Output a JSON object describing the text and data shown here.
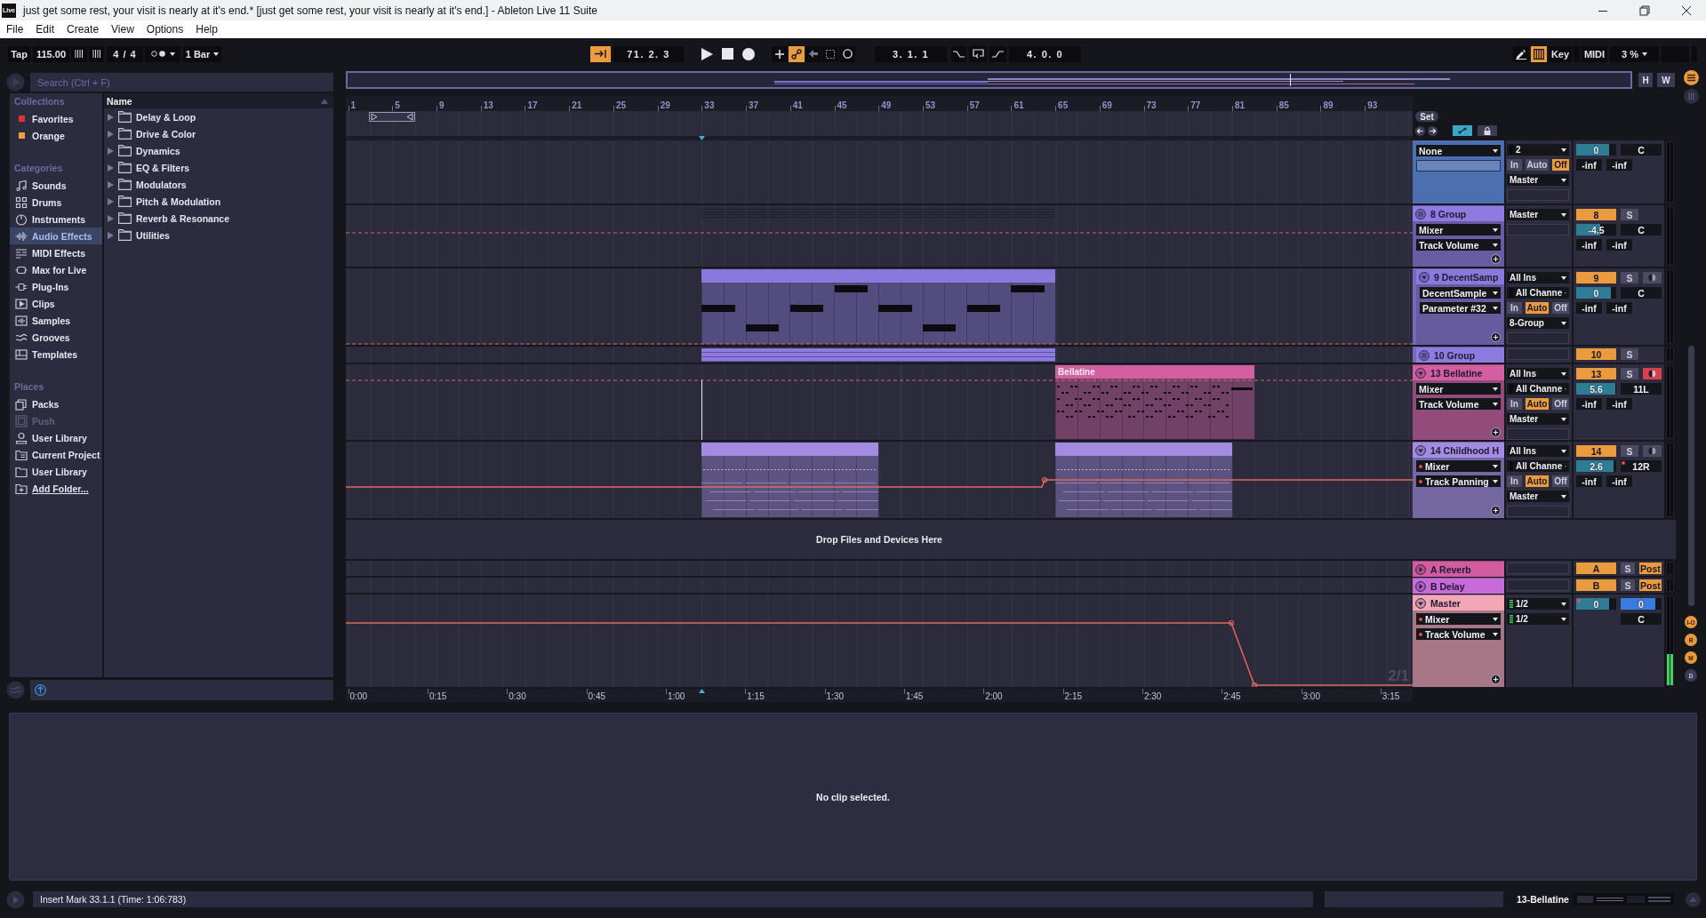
{
  "window": {
    "logo": "Live",
    "title": "just get some rest, your visit is nearly at it's end.*  [just get some rest, your visit is nearly at it's end.] - Ableton Live 11 Suite"
  },
  "menu": [
    "File",
    "Edit",
    "Create",
    "View",
    "Options",
    "Help"
  ],
  "toolbar": {
    "tap": "Tap",
    "tempo": "115.00",
    "signature": "4 / 4",
    "quantize": "1 Bar",
    "follow": true,
    "position": "71. 2. 3",
    "playing": false,
    "recording": false,
    "automation_arm": true,
    "loop_start": "3. 1. 1",
    "loop": false,
    "loop_length": "4. 0. 0",
    "draw_mode": false,
    "computer_keyboard": true,
    "key": "Key",
    "midi": "MIDI",
    "cpu": "3 %"
  },
  "browser": {
    "search_placeholder": "Search (Ctrl + F)",
    "sections": [
      {
        "heading": "Collections",
        "items": [
          {
            "label": "Favorites",
            "color": "#e5312d",
            "selected": false
          },
          {
            "label": "Orange",
            "color": "#eba33f",
            "selected": false
          }
        ]
      },
      {
        "heading": "Categories",
        "items": [
          {
            "label": "Sounds",
            "selected": false
          },
          {
            "label": "Drums",
            "selected": false
          },
          {
            "label": "Instruments",
            "selected": false
          },
          {
            "label": "Audio Effects",
            "selected": true
          },
          {
            "label": "MIDI Effects",
            "selected": false
          },
          {
            "label": "Max for Live",
            "selected": false
          },
          {
            "label": "Plug-Ins",
            "selected": false
          },
          {
            "label": "Clips",
            "selected": false
          },
          {
            "label": "Samples",
            "selected": false
          },
          {
            "label": "Grooves",
            "selected": false
          },
          {
            "label": "Templates",
            "selected": false
          }
        ]
      },
      {
        "heading": "Places",
        "items": [
          {
            "label": "Packs",
            "kind": "place",
            "selected": false,
            "disabled": false
          },
          {
            "label": "Push",
            "kind": "place",
            "selected": false,
            "disabled": true
          },
          {
            "label": "User Library",
            "kind": "place",
            "selected": false,
            "disabled": false
          },
          {
            "label": "Current Project",
            "kind": "place",
            "selected": false,
            "disabled": false
          },
          {
            "label": "User Library",
            "kind": "place",
            "selected": false,
            "disabled": false
          },
          {
            "label": "Add Folder...",
            "kind": "link",
            "selected": false,
            "disabled": false
          }
        ]
      }
    ],
    "column_header": "Name",
    "items": [
      {
        "label": "Delay & Loop",
        "expanded": false
      },
      {
        "label": "Drive & Color",
        "expanded": false
      },
      {
        "label": "Dynamics",
        "expanded": false
      },
      {
        "label": "EQ & Filters",
        "expanded": false
      },
      {
        "label": "Modulators",
        "expanded": false
      },
      {
        "label": "Pitch & Modulation",
        "expanded": false
      },
      {
        "label": "Reverb & Resonance",
        "expanded": false
      },
      {
        "label": "Utilities",
        "expanded": false
      }
    ]
  },
  "arrangement": {
    "overview_buttons": [
      "H",
      "W"
    ],
    "bar_ruler": [
      "1",
      "5",
      "9",
      "13",
      "17",
      "21",
      "25",
      "29",
      "33",
      "37",
      "41",
      "45",
      "49",
      "53",
      "57",
      "61",
      "65",
      "69",
      "73",
      "77",
      "81",
      "85",
      "89",
      "93"
    ],
    "set_button": "Set",
    "automation_mode": true,
    "lock": false,
    "tracks": [
      {
        "color": "#4c6fb0",
        "choosers": [
          {
            "kind": "chooser",
            "label": "None",
            "automated": false
          },
          {
            "kind": "blank"
          }
        ],
        "io": [
          {
            "kind": "channel",
            "label": "2",
            "active": false
          },
          {
            "kind": "monitor",
            "options": [
              {
                "label": "In",
                "selected": false
              },
              {
                "label": "Auto",
                "selected": false
              },
              {
                "label": "Off",
                "selected": true
              }
            ]
          },
          {
            "kind": "chooser",
            "label": "Master"
          },
          {
            "kind": "blank"
          }
        ],
        "mixer": {
          "volume": {
            "value": "0",
            "level": 0.82,
            "automated": false
          },
          "pan": {
            "value": "C",
            "automated": false
          },
          "peaks": [
            "-inf",
            "-inf"
          ]
        }
      },
      {
        "name": "8 Group",
        "kind": "group",
        "expanded": true,
        "color": "#8f7ae0",
        "choosers": [
          {
            "kind": "chooser",
            "label": "Mixer",
            "automated": false
          },
          {
            "kind": "chooser",
            "label": "Track Volume",
            "automated": false
          }
        ],
        "io": [
          {
            "kind": "chooser",
            "label": "Master"
          },
          {
            "kind": "blank"
          }
        ],
        "mixer": {
          "activator": {
            "label": "8",
            "on": true
          },
          "solo": {
            "label": "S",
            "on": false
          },
          "volume": {
            "value": "-4.5",
            "level": 0.6,
            "automated": false
          },
          "pan": {
            "value": "C",
            "automated": false
          },
          "peaks": [
            "-inf",
            "-inf"
          ]
        },
        "clips": [
          {
            "kind": "outline"
          }
        ],
        "children": [
          {
            "name": "9 DecentSamp",
            "kind": "track",
            "expanded": true,
            "color": "#8a79dc",
            "choosers": [
              {
                "kind": "chooser",
                "label": "DecentSample",
                "automated": false
              },
              {
                "kind": "chooser",
                "label": "Parameter #32",
                "automated": false
              }
            ],
            "io": [
              {
                "kind": "chooser",
                "label": "All Ins"
              },
              {
                "kind": "channel",
                "label": "All Channe",
                "active": false
              },
              {
                "kind": "monitor",
                "options": [
                  {
                    "label": "In",
                    "selected": false
                  },
                  {
                    "label": "Auto",
                    "selected": true
                  },
                  {
                    "label": "Off",
                    "selected": false
                  }
                ]
              },
              {
                "kind": "chooser",
                "label": "8-Group"
              },
              {
                "kind": "blank"
              }
            ],
            "mixer": {
              "activator": {
                "label": "9",
                "on": true
              },
              "solo": {
                "label": "S",
                "on": false
              },
              "arm": {
                "on": false
              },
              "volume": {
                "value": "0",
                "level": 0.86,
                "automated": false
              },
              "pan": {
                "value": "C",
                "automated": false
              },
              "peaks": [
                "-inf",
                "-inf"
              ]
            },
            "clips": [
              {
                "kind": "midi"
              }
            ]
          },
          {
            "name": "10 Group",
            "kind": "group",
            "expanded": false,
            "color": "#8f7ae0",
            "io": [
              {
                "kind": "blank"
              }
            ],
            "mixer": {
              "activator": {
                "label": "10",
                "on": true
              },
              "solo": {
                "label": "S",
                "on": false
              }
            },
            "clips": [
              {
                "kind": "overview"
              }
            ]
          }
        ]
      },
      {
        "name": "13 Bellatine",
        "kind": "track",
        "expanded": true,
        "color": "#d35fa2",
        "choosers": [
          {
            "kind": "chooser",
            "label": "Mixer",
            "automated": false
          },
          {
            "kind": "chooser",
            "label": "Track Volume",
            "automated": false
          }
        ],
        "io": [
          {
            "kind": "chooser",
            "label": "All Ins"
          },
          {
            "kind": "channel",
            "label": "All Channe",
            "active": false
          },
          {
            "kind": "monitor",
            "options": [
              {
                "label": "In",
                "selected": false
              },
              {
                "label": "Auto",
                "selected": true
              },
              {
                "label": "Off",
                "selected": false
              }
            ]
          },
          {
            "kind": "chooser",
            "label": "Master"
          },
          {
            "kind": "blank"
          }
        ],
        "mixer": {
          "activator": {
            "label": "13",
            "on": true
          },
          "solo": {
            "label": "S",
            "on": false
          },
          "arm": {
            "on": true
          },
          "volume": {
            "value": "5.6",
            "level": 0.98,
            "automated": false
          },
          "pan": {
            "value": "11L",
            "automated": false
          },
          "peaks": [
            "-inf",
            "-inf"
          ]
        },
        "clips": [
          {
            "kind": "midi",
            "name": "Bellatine"
          }
        ]
      },
      {
        "name": "14 Childhood H",
        "kind": "track",
        "expanded": true,
        "color": "#a28be0",
        "choosers": [
          {
            "kind": "chooser",
            "label": "Mixer",
            "automated": true
          },
          {
            "kind": "chooser",
            "label": "Track Panning",
            "automated": true
          }
        ],
        "io": [
          {
            "kind": "chooser",
            "label": "All Ins"
          },
          {
            "kind": "channel",
            "label": "All Channe",
            "active": false
          },
          {
            "kind": "monitor",
            "options": [
              {
                "label": "In",
                "selected": false
              },
              {
                "label": "Auto",
                "selected": true
              },
              {
                "label": "Off",
                "selected": false
              }
            ]
          },
          {
            "kind": "chooser",
            "label": "Master"
          },
          {
            "kind": "blank"
          }
        ],
        "mixer": {
          "activator": {
            "label": "14",
            "on": true
          },
          "solo": {
            "label": "S",
            "on": false
          },
          "arm": {
            "on": false
          },
          "volume": {
            "value": "2.6",
            "level": 0.93,
            "automated": false
          },
          "pan": {
            "value": "12R",
            "automated": true
          },
          "peaks": [
            "-inf",
            "-inf"
          ]
        },
        "clips": [
          {
            "kind": "audio"
          },
          {
            "kind": "audio"
          }
        ]
      }
    ],
    "drop_hint": "Drop Files and Devices Here",
    "return_tracks": [
      {
        "name": "A Reverb",
        "kind": "track",
        "expanded": false,
        "color": "#d15c9f",
        "io": [
          {
            "kind": "blank"
          }
        ],
        "mixer": {
          "activator": {
            "label": "A",
            "on": true
          },
          "solo": {
            "label": "S",
            "on": false
          },
          "post": {
            "label": "Post",
            "on": true
          }
        }
      },
      {
        "name": "B Delay",
        "kind": "track",
        "expanded": false,
        "color": "#c66bd9",
        "io": [
          {
            "kind": "blank"
          }
        ],
        "mixer": {
          "activator": {
            "label": "B",
            "on": true
          },
          "solo": {
            "label": "S",
            "on": false
          },
          "post": {
            "label": "Post",
            "on": true
          }
        }
      }
    ],
    "master_track": {
      "name": "Master",
      "kind": "track",
      "expanded": true,
      "color": "#f3a6b6",
      "choosers": [
        {
          "kind": "chooser",
          "label": "Mixer",
          "automated": true
        },
        {
          "kind": "chooser",
          "label": "Track Volume",
          "automated": true
        }
      ],
      "io": [
        {
          "kind": "channel",
          "label": "1/2",
          "active": true
        },
        {
          "kind": "channel",
          "label": "1/2",
          "active": true
        }
      ],
      "mixer": {
        "volume": {
          "value": "0",
          "level": 0.82,
          "automated": true
        },
        "cue": {
          "value": "0",
          "level": 0.84
        },
        "pan": {
          "value": "C",
          "automated": false
        }
      },
      "meter": {
        "level": 0.35
      },
      "lane_label": "2/1"
    },
    "time_ruler": [
      "0:00",
      "0:15",
      "0:30",
      "0:45",
      "1:00",
      "1:15",
      "1:30",
      "1:45",
      "2:00",
      "2:15",
      "2:30",
      "2:45",
      "3:00",
      "3:15"
    ],
    "view_toggles": [
      {
        "label": "I-O",
        "on": true
      },
      {
        "label": "R",
        "on": true
      },
      {
        "label": "M",
        "on": true
      },
      {
        "label": "D",
        "on": false
      }
    ]
  },
  "detail": {
    "message": "No clip selected."
  },
  "status_bar": {
    "message": "Insert Mark 33.1.1 (Time: 1:06:783)",
    "selected_track": "13-Bellatine"
  }
}
